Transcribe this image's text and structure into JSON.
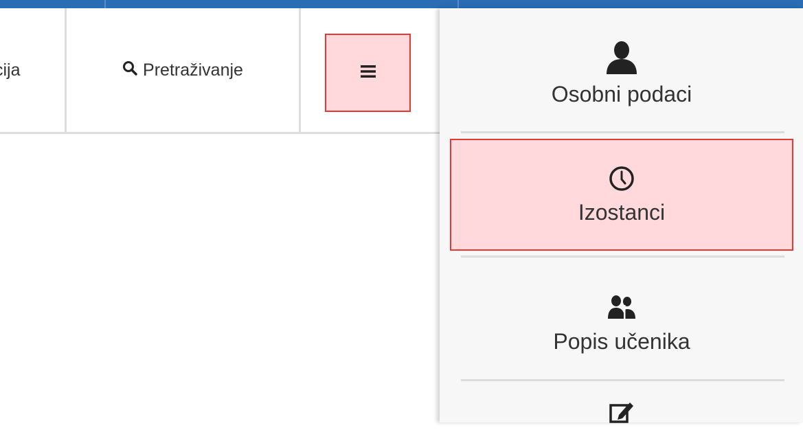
{
  "navbar": {
    "cut_item_label": "Lokacija",
    "cut_visible_text": "cija",
    "search_label": "Pretraživanje",
    "menu_icon": "hamburger-icon"
  },
  "side_menu": {
    "items": [
      {
        "label": "Osobni podaci",
        "icon": "user-icon",
        "highlighted": false
      },
      {
        "label": "Izostanci",
        "icon": "clock-icon",
        "highlighted": true
      },
      {
        "label": "Popis učenika",
        "icon": "users-icon",
        "highlighted": false
      },
      {
        "label": "",
        "icon": "edit-icon",
        "highlighted": false
      }
    ]
  },
  "colors": {
    "top_bar": "#2a6db5",
    "highlight_border": "#e53935",
    "highlight_fill": "#ffd9dc",
    "icon": "#222222"
  }
}
